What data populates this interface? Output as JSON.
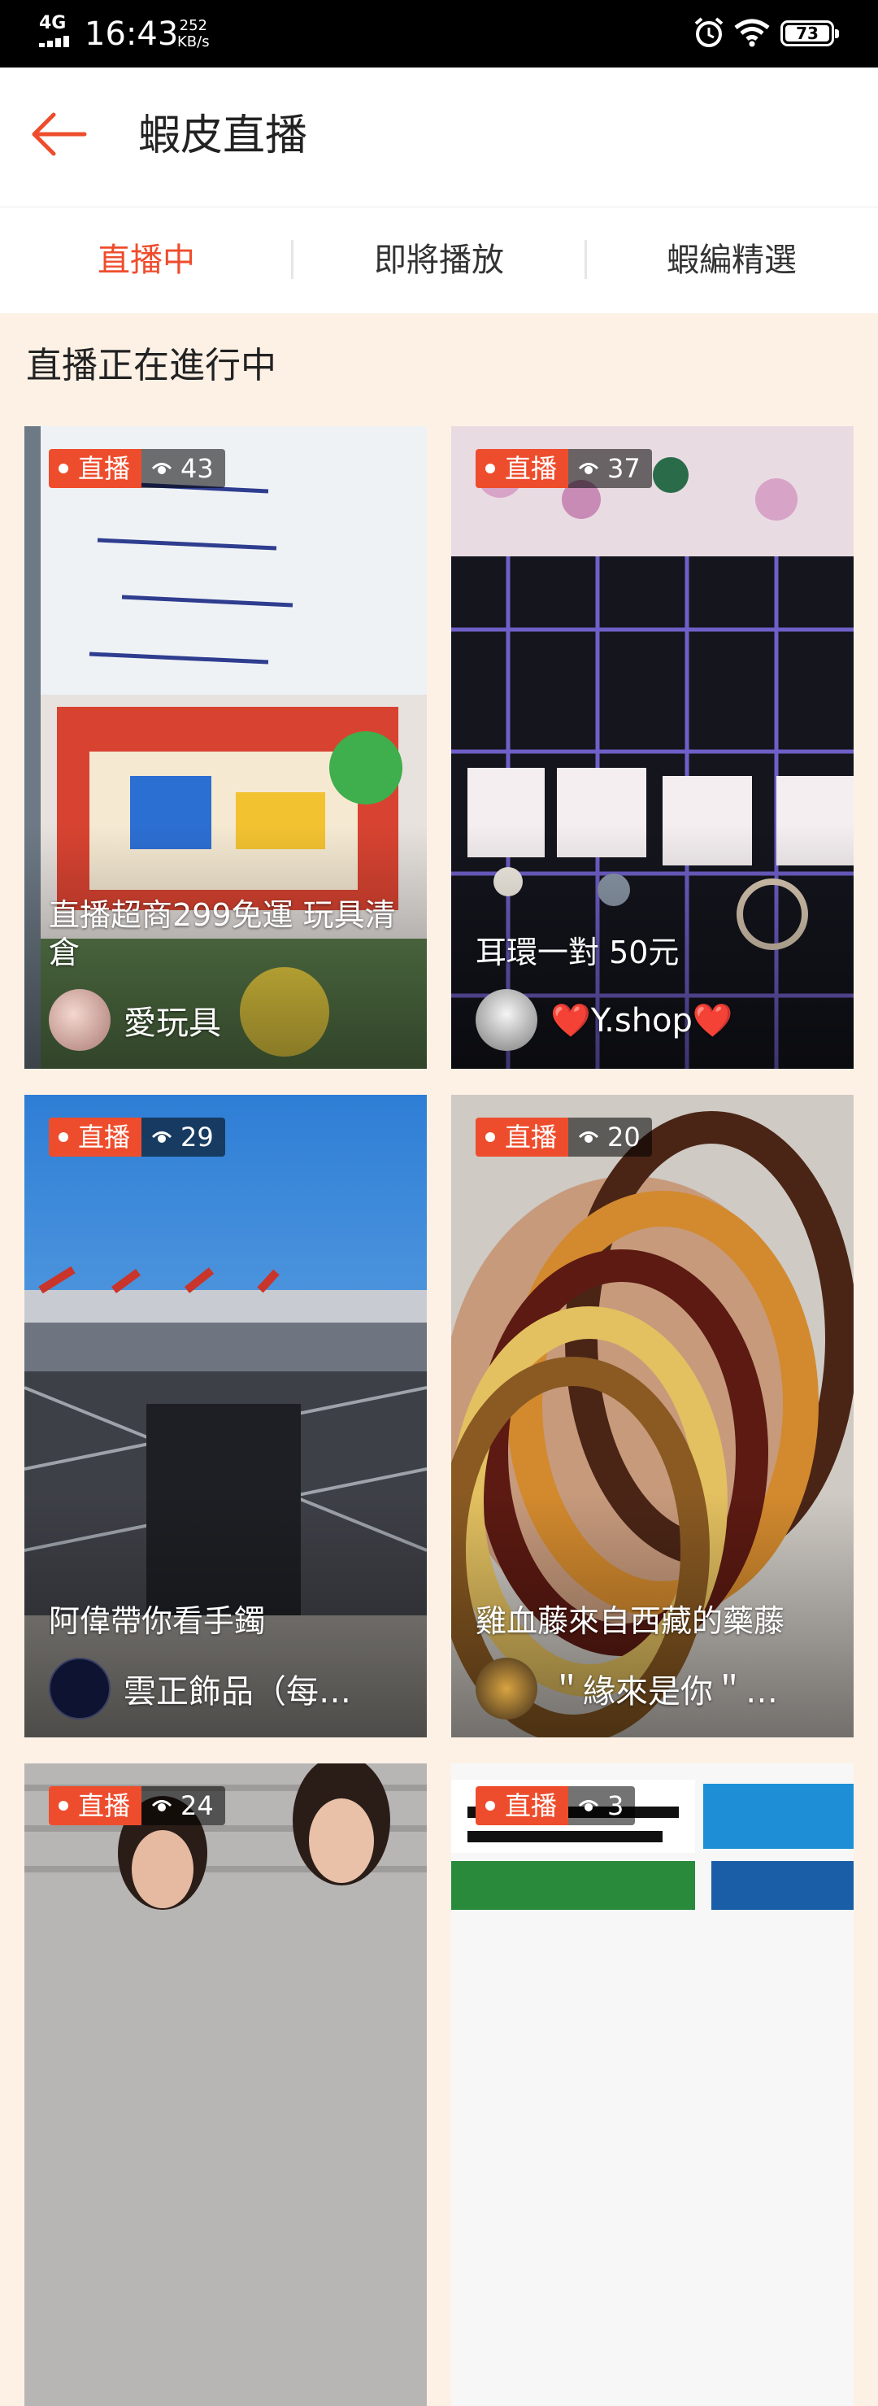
{
  "status_bar": {
    "network": "4G",
    "time": "16:43",
    "speed_value": "252",
    "speed_unit": "KB/s",
    "battery": "73",
    "icons": [
      "signal-icon",
      "alarm-icon",
      "wifi-icon",
      "battery-icon"
    ]
  },
  "header": {
    "back_icon": "arrow-left-icon",
    "title": "蝦皮直播"
  },
  "tabs": [
    {
      "label": "直播中",
      "active": true
    },
    {
      "label": "即將播放",
      "active": false
    },
    {
      "label": "蝦編精選",
      "active": false
    }
  ],
  "section_title": "直播正在進行中",
  "streams": [
    {
      "badge": "直播",
      "views": "43",
      "title": "直播超商299免運 玩具清倉",
      "seller": "愛玩具"
    },
    {
      "badge": "直播",
      "views": "37",
      "title": "耳環一對 50元",
      "seller": "❤️Y.shop❤️"
    },
    {
      "badge": "直播",
      "views": "29",
      "title": "阿偉帶你看手鐲",
      "seller": "雲正飾品（每…"
    },
    {
      "badge": "直播",
      "views": "20",
      "title": "雞血藤來自西藏的藥藤",
      "seller": "＂緣來是你＂…"
    },
    {
      "badge": "直播",
      "views": "24",
      "title": "",
      "seller": ""
    },
    {
      "badge": "直播",
      "views": "3",
      "title": "",
      "seller": ""
    }
  ],
  "colors": {
    "accent": "#ee4d2d",
    "background": "#fdf1e6"
  }
}
